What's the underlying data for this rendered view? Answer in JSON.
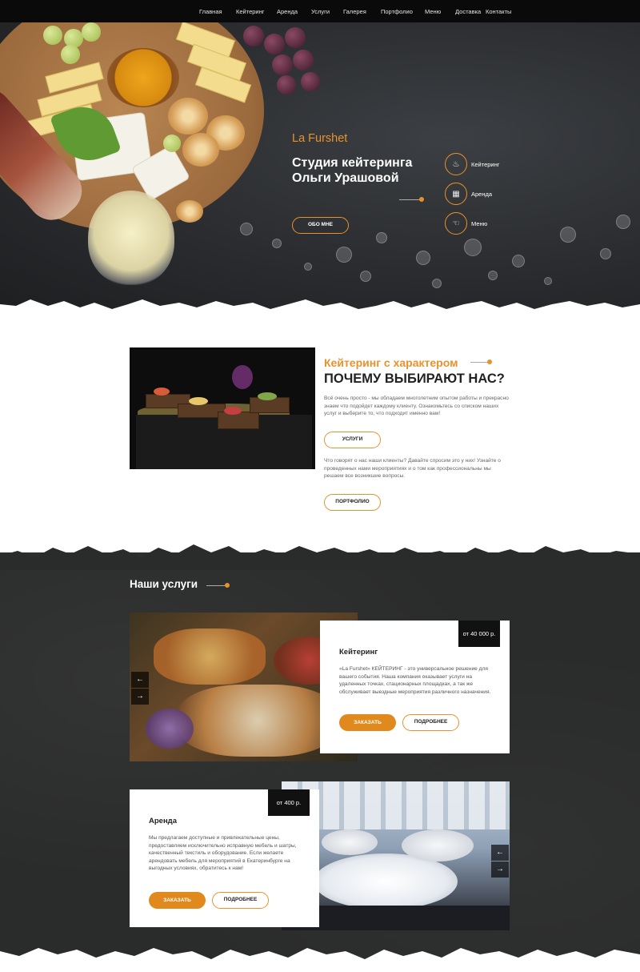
{
  "nav": [
    "Главная",
    "Кейтеринг",
    "Аренда",
    "Услуги",
    "Галерея",
    "Портфолио",
    "Меню",
    "Доставка",
    "Контакты"
  ],
  "hero": {
    "brand": "La Furshet",
    "title_line1": "Студия кейтеринга",
    "title_line2": "Ольги Урашовой",
    "button": "ОБО МНЕ",
    "side": [
      {
        "icon": "catering-icon",
        "label": "Кейтеринг"
      },
      {
        "icon": "calendar-icon",
        "label": "Аренда"
      },
      {
        "icon": "menu-icon",
        "label": "Меню"
      }
    ]
  },
  "about": {
    "subtitle": "Кейтеринг с характером",
    "title": "ПОЧЕМУ ВЫБИРАЮТ НАС?",
    "text1": "Всё очень просто - мы обладаем многолетним опытом работы и прекрасно знаем что подойдет каждому клиенту. Ознакомьтесь со списком наших услуг и выберите то, что подходит именно вам!",
    "button1": "УСЛУГИ",
    "text2": "Что говорят о нас наши клиенты? Давайте спросим это у них! Узнайте о проведенных нами мероприятиях и о том как профессиональны мы решаем все возникшие вопросы.",
    "button2": "ПОРТФОЛИО"
  },
  "services": {
    "title": "Наши услуги",
    "items": [
      {
        "price": "от 40 000 р.",
        "name": "Кейтеринг",
        "text": "«La Furshet» КЕЙТЕРИНГ - это универсальное решение для вашего события. Наша компания оказывает услуги на удаленных точках, стационарных площадках, а так же обслуживает выездные мероприятия различного назначения.",
        "order": "ЗАКАЗАТЬ",
        "more": "ПОДРОБНЕЕ"
      },
      {
        "price": "от 400 р.",
        "name": "Аренда",
        "text": "Мы предлагаем доступные и привлекательные цены, предоставляем исключительно исправную мебель и шатры, качественный текстиль и оборудование. Если желаете арендовать мебель для мероприятий в Екатеринбурге на выгодных условиях, обратитесь к нам!",
        "order": "ЗАКАЗАТЬ",
        "more": "ПОДРОБНЕЕ"
      }
    ]
  },
  "colors": {
    "accent": "#e8922e",
    "dark": "#2a2b2b"
  }
}
